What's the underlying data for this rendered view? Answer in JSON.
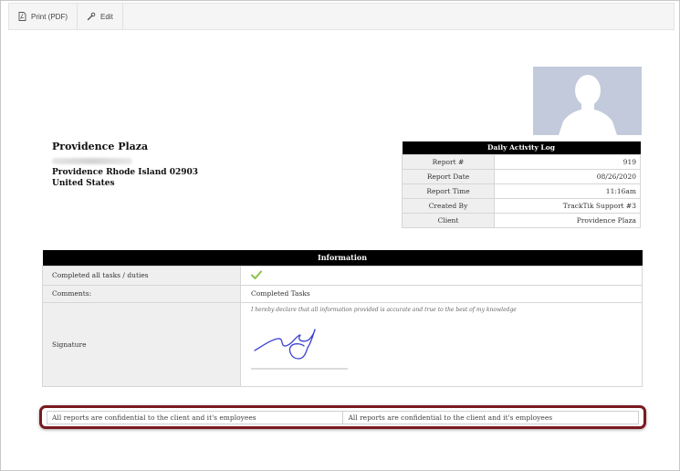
{
  "toolbar": {
    "print_label": "Print (PDF)",
    "edit_label": "Edit"
  },
  "site": {
    "name": "Providence Plaza",
    "city_line": "Providence Rhode Island 02903",
    "country": "United States"
  },
  "log": {
    "title": "Daily Activity Log",
    "rows": [
      {
        "label": "Report #",
        "value": "919"
      },
      {
        "label": "Report Date",
        "value": "08/26/2020"
      },
      {
        "label": "Report Time",
        "value": "11:16am"
      },
      {
        "label": "Created By",
        "value": "TrackTik Support #3"
      },
      {
        "label": "Client",
        "value": "Providence Plaza"
      }
    ]
  },
  "info": {
    "title": "Information",
    "tasks_label": "Completed all tasks / duties",
    "tasks_value_icon": "check-icon",
    "comments_label": "Comments:",
    "comments_value": "Completed Tasks",
    "signature_label": "Signature",
    "declaration": "I hereby declare that all information provided is accurate and true to the best of my knowledge"
  },
  "footer": {
    "left": "All reports are confidential to the client and it's employees",
    "right": "All reports are confidential to the client and it's employees"
  },
  "colors": {
    "header_bg": "#000000",
    "label_bg": "#efefef",
    "avatar_bg": "#c2cadb",
    "check": "#8bc34a",
    "highlight_border": "#7a1a1f",
    "signature_ink": "#3b3fd1"
  }
}
